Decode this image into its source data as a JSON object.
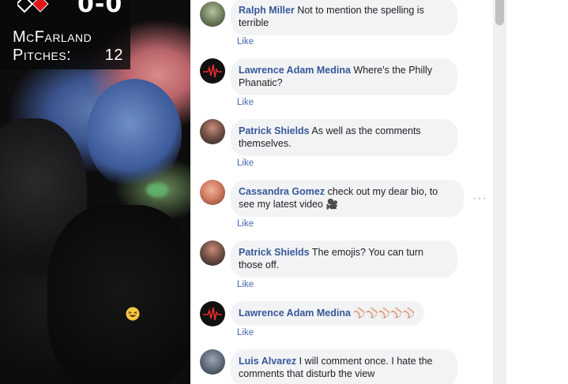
{
  "scoreboard": {
    "score": "0-0",
    "pitcher_name": "McFarland",
    "pitches_label": "Pitches:",
    "pitch_count": "12"
  },
  "comments": [
    {
      "author": "Ralph Miller",
      "text": "Not to mention the spelling is terrible",
      "action": "Like",
      "avatar": "photo-avatar"
    },
    {
      "author": "Lawrence Adam Medina",
      "text": "Where's the Philly Phanatic?",
      "action": "Like",
      "avatar": "heartbeat-avatar"
    },
    {
      "author": "Patrick Shields",
      "text": "As well as the comments themselves.",
      "action": "Like",
      "avatar": "photo-avatar"
    },
    {
      "author": "Cassandra Gomez",
      "text": "check out my dear bio, to see my latest video 🎥",
      "action": "Like",
      "avatar": "photo-avatar"
    },
    {
      "author": "Patrick Shields",
      "text": "The emojis? You can turn those off.",
      "action": "Like",
      "avatar": "photo-avatar"
    },
    {
      "author": "Lawrence Adam Medina",
      "text": "⚾⚾⚾⚾⚾",
      "action": "Like",
      "avatar": "heartbeat-avatar"
    },
    {
      "author": "Luis Alvarez",
      "text": "I will comment once. I hate the comments that disturb the view",
      "action": "",
      "avatar": "photo-avatar"
    }
  ],
  "more_options": "···",
  "icons": {
    "bases": "base-diamond-icon",
    "float_emoji": "laughing-emoji-icon",
    "heartbeat": "heartbeat-icon",
    "more": "more-options-icon"
  },
  "colors": {
    "author": "#385898",
    "like": "#4267b2",
    "bubble": "#f2f3f5"
  }
}
